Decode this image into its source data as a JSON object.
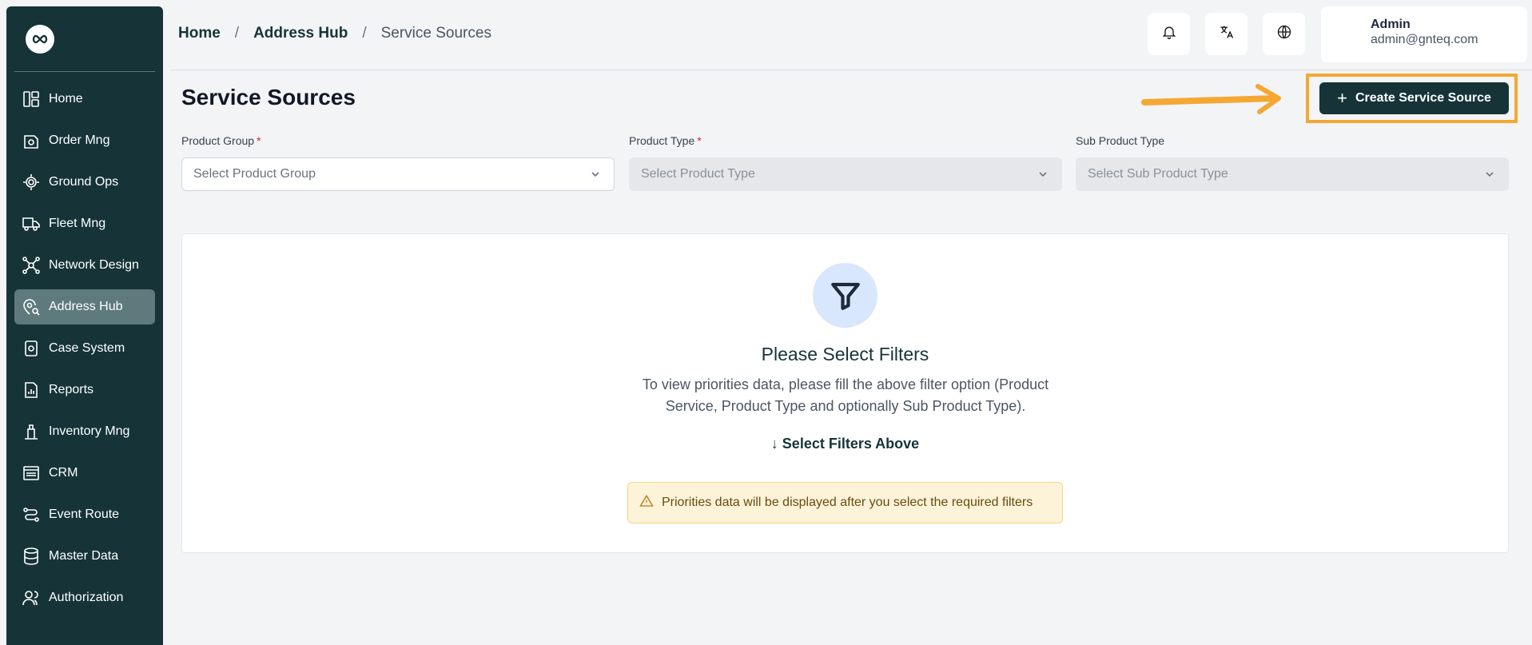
{
  "sidebar": {
    "logo_icon": "infinity-logo-icon",
    "items": [
      {
        "label": "Home",
        "icon": "layout-icon"
      },
      {
        "label": "Order Mng",
        "icon": "package-icon"
      },
      {
        "label": "Ground Ops",
        "icon": "gear-scan-icon"
      },
      {
        "label": "Fleet Mng",
        "icon": "truck-icon"
      },
      {
        "label": "Network Design",
        "icon": "network-icon"
      },
      {
        "label": "Address Hub",
        "icon": "map-pin-search-icon",
        "active": true
      },
      {
        "label": "Case System",
        "icon": "case-file-icon"
      },
      {
        "label": "Reports",
        "icon": "report-icon"
      },
      {
        "label": "Inventory Mng",
        "icon": "inventory-icon"
      },
      {
        "label": "CRM",
        "icon": "crm-icon"
      },
      {
        "label": "Event Route",
        "icon": "route-icon"
      },
      {
        "label": "Master Data",
        "icon": "database-icon"
      },
      {
        "label": "Authorization",
        "icon": "users-icon"
      }
    ]
  },
  "header": {
    "breadcrumb": [
      "Home",
      "Address Hub",
      "Service Sources"
    ],
    "breadcrumb_sep": "/",
    "user": {
      "name": "Admin",
      "email": "admin@gnteq.com"
    }
  },
  "page": {
    "title": "Service Sources",
    "create_button": "Create Service Source"
  },
  "filters": [
    {
      "label": "Product Group",
      "required": true,
      "placeholder": "Select Product Group",
      "disabled": false
    },
    {
      "label": "Product Type",
      "required": true,
      "placeholder": "Select Product Type",
      "disabled": true
    },
    {
      "label": "Sub Product Type",
      "required": false,
      "placeholder": "Select Sub Product Type",
      "disabled": true
    }
  ],
  "empty_state": {
    "title": "Please Select Filters",
    "description": "To view priorities data, please fill the above filter option (Product Service, Product Type and optionally Sub Product Type).",
    "hint": "Select Filters Above",
    "warning": "Priorities data will be displayed after you select the required filters"
  },
  "colors": {
    "brand_dark": "#163438",
    "highlight": "#f4a833",
    "warning_bg": "#fdf3d8"
  }
}
